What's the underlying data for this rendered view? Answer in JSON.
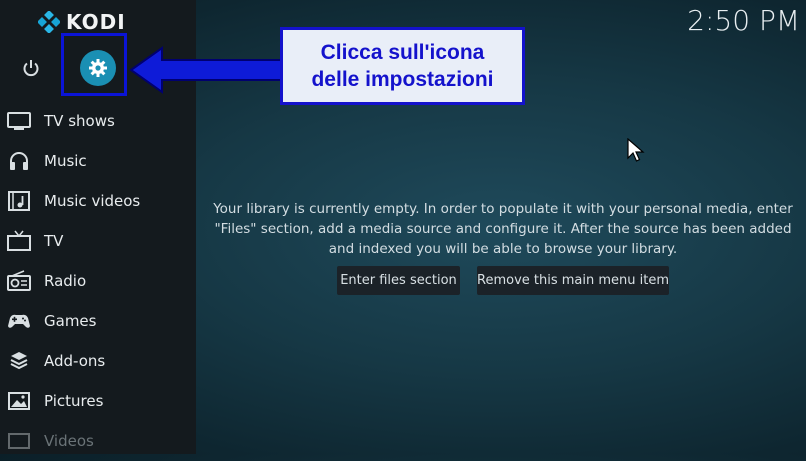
{
  "app": {
    "logo_text": "KODI"
  },
  "clock": {
    "time": "2:50 PM"
  },
  "top_buttons": {
    "power_icon": "power-icon",
    "settings_icon": "gear-icon"
  },
  "sidebar": {
    "items": [
      {
        "label": "TV shows",
        "icon": "tv-icon"
      },
      {
        "label": "Music",
        "icon": "headphones-icon"
      },
      {
        "label": "Music videos",
        "icon": "music-video-icon"
      },
      {
        "label": "TV",
        "icon": "live-tv-icon"
      },
      {
        "label": "Radio",
        "icon": "radio-icon"
      },
      {
        "label": "Games",
        "icon": "gamepad-icon"
      },
      {
        "label": "Add-ons",
        "icon": "addons-icon"
      },
      {
        "label": "Pictures",
        "icon": "pictures-icon"
      },
      {
        "label": "Videos",
        "icon": "video-icon"
      }
    ]
  },
  "main": {
    "message_line1": "Your library is currently empty. In order to populate it with your personal media, enter",
    "message_line2": "\"Files\" section, add a media source and configure it. After the source has been added",
    "message_line3": "and indexed you will be able to browse your library.",
    "enter_files_label": "Enter files section",
    "remove_item_label": "Remove this main menu item"
  },
  "annotation": {
    "line1": "Clicca sull'icona",
    "line2": "delle impostazioni",
    "color": "#1412cc"
  }
}
